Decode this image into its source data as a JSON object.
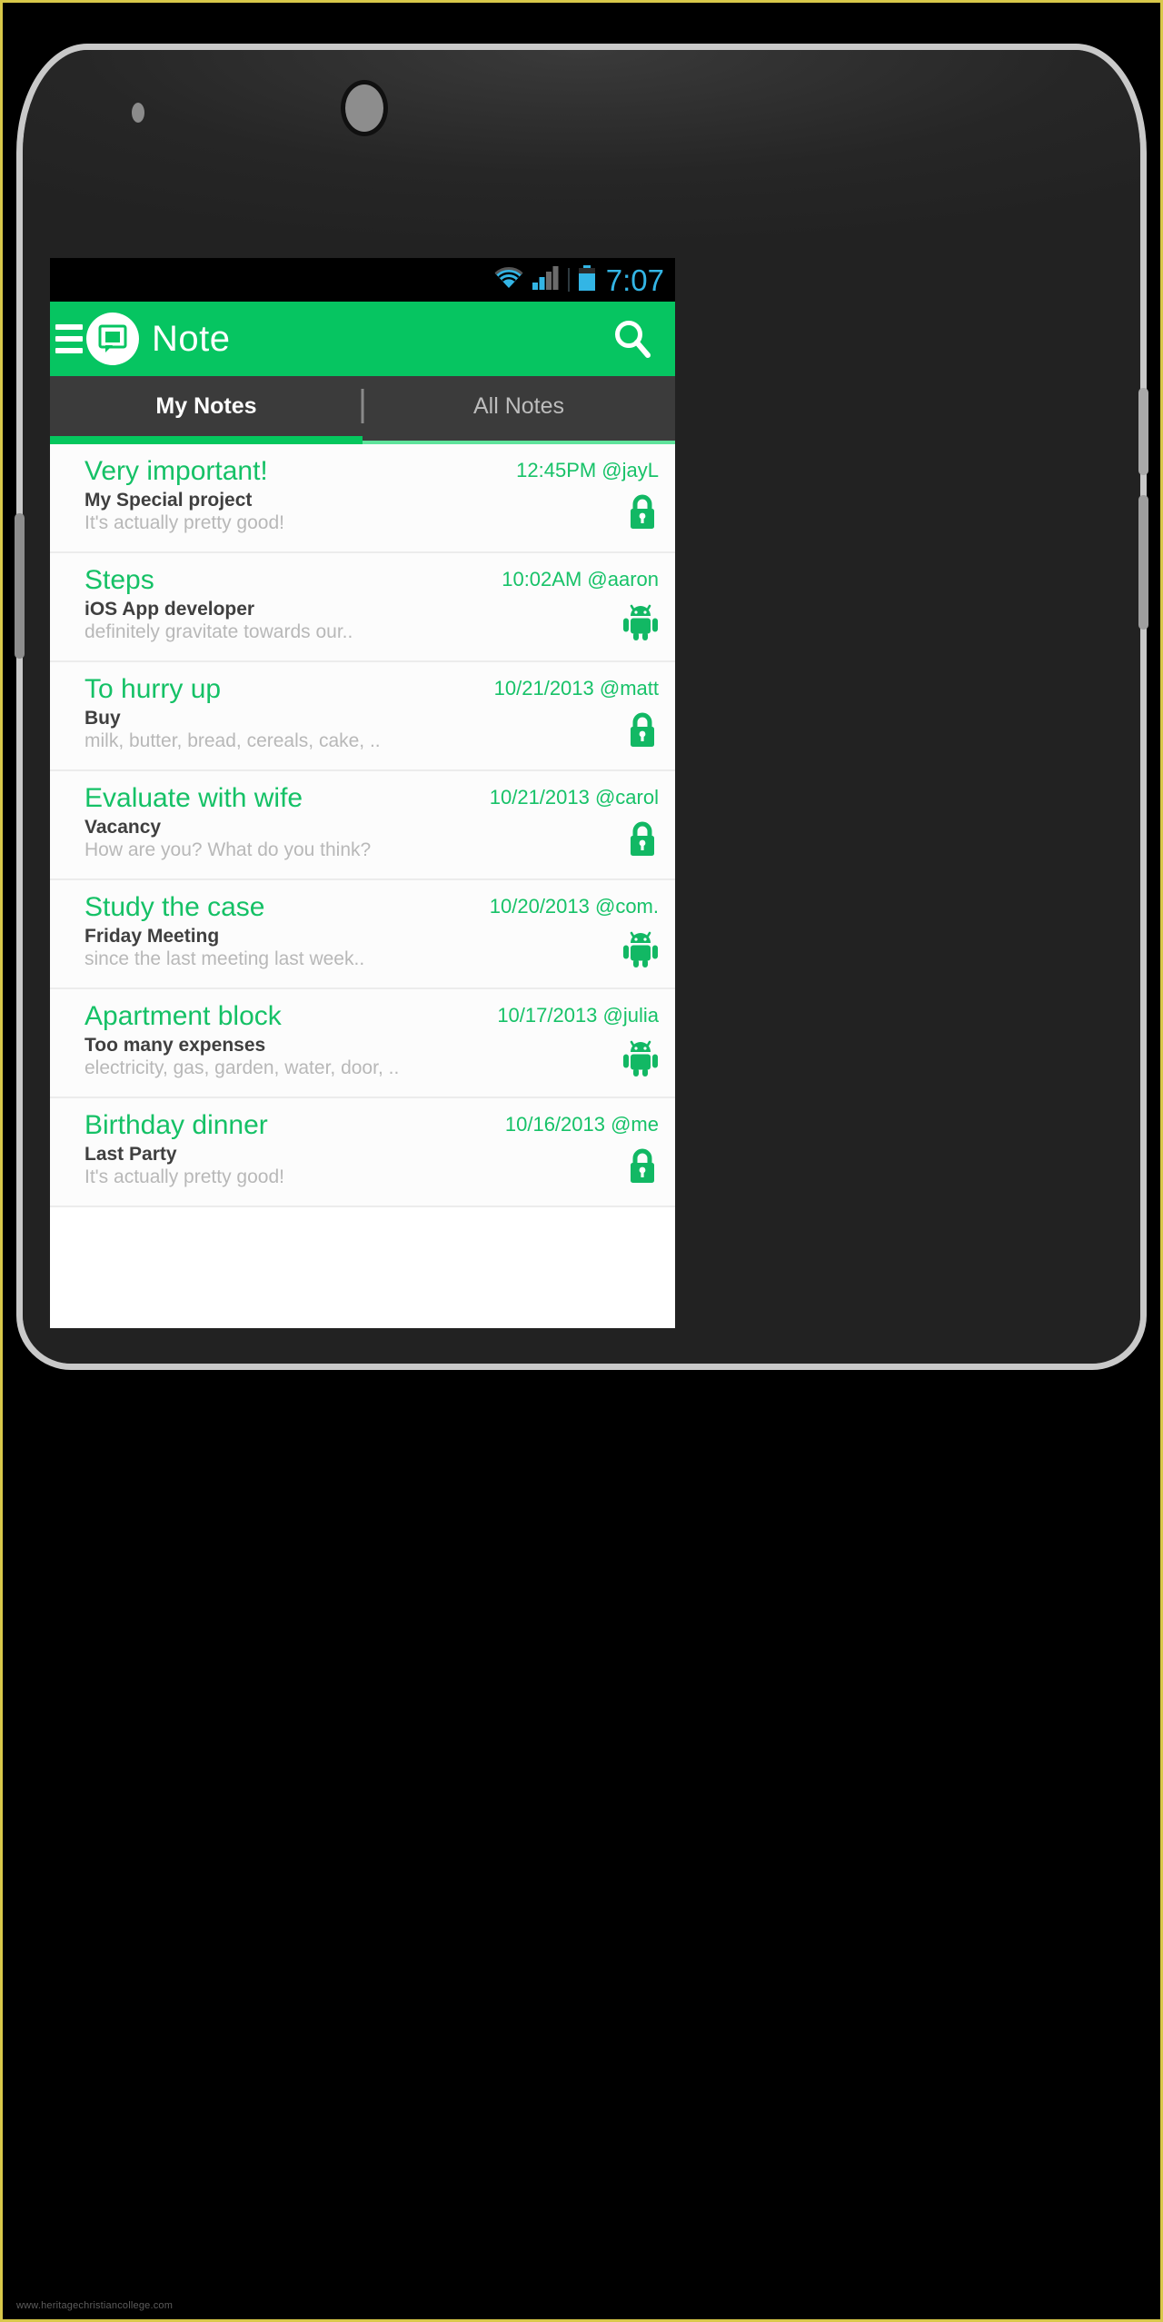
{
  "status_bar": {
    "time": "7:07",
    "wifi_icon": "wifi-icon",
    "signal_icon": "cellular-signal-icon",
    "battery_icon": "battery-icon",
    "accent_color": "#33b5e5"
  },
  "app_bar": {
    "menu_icon": "hamburger-menu-icon",
    "logo_icon": "note-app-logo-icon",
    "title": "Note",
    "search_icon": "search-icon",
    "background_color": "#06c561"
  },
  "tabs": [
    {
      "label": "My Notes",
      "active": true
    },
    {
      "label": "All Notes",
      "active": false
    }
  ],
  "theme": {
    "accent_green": "#06c561",
    "title_green": "#15c166",
    "meta_green": "#17c268",
    "tab_bar_bg": "#3b3b3b",
    "status_bar_bg": "#000000"
  },
  "notes": [
    {
      "title": "Very important!",
      "subtitle": "My Special project",
      "preview": "It's actually pretty good!",
      "meta": "12:45PM @jayL",
      "status_icon": "lock-icon"
    },
    {
      "title": "Steps",
      "subtitle": "iOS App developer",
      "preview": "definitely gravitate towards our..",
      "meta": "10:02AM  @aaron",
      "status_icon": "android-robot-icon"
    },
    {
      "title": "To hurry up",
      "subtitle": "Buy",
      "preview": "milk, butter, bread, cereals, cake, ..",
      "meta": "10/21/2013 @matt",
      "status_icon": "lock-icon"
    },
    {
      "title": "Evaluate with wife",
      "subtitle": "Vacancy",
      "preview": "How are you? What do you think?",
      "meta": "10/21/2013 @carol",
      "status_icon": "lock-icon"
    },
    {
      "title": "Study the case",
      "subtitle": "Friday Meeting",
      "preview": "since the last meeting last week..",
      "meta": "10/20/2013 @com.",
      "status_icon": "android-robot-icon"
    },
    {
      "title": "Apartment block",
      "subtitle": "Too many expenses",
      "preview": "electricity, gas, garden, water, door, ..",
      "meta": "10/17/2013 @julia",
      "status_icon": "android-robot-icon"
    },
    {
      "title": "Birthday dinner",
      "subtitle": "Last Party",
      "preview": "It's actually pretty good!",
      "meta": "10/16/2013 @me",
      "status_icon": "lock-icon"
    }
  ],
  "watermark": "www.heritagechristiancollege.com"
}
